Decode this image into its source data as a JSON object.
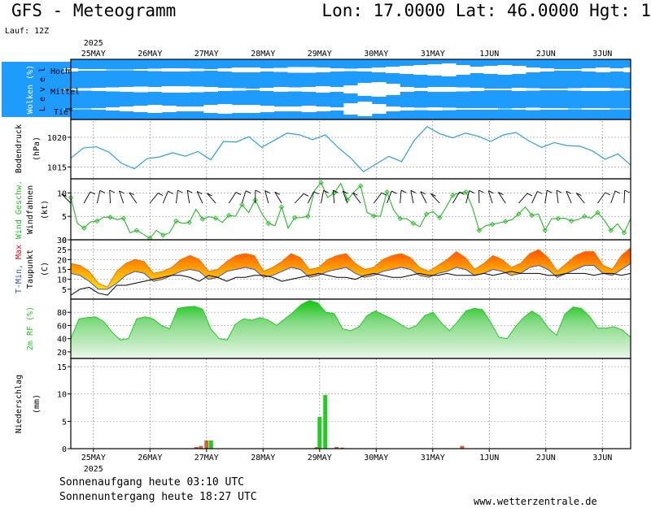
{
  "header": {
    "title": "GFS - Meteogramm",
    "coordinates": "Lon: 17.0000 Lat: 46.0000 Hgt: 1",
    "run": "Lauf: 12Z"
  },
  "footer": {
    "sunrise": "Sonnenaufgang heute 03:10 UTC",
    "sunset": "Sonnenuntergang heute 18:27 UTC",
    "source": "www.wetterzentrale.de"
  },
  "colors": {
    "cloud_bg": "#1e9bff",
    "cloud_fill": "#ffffff",
    "pressure_line": "#2aa0e0",
    "wind_line": "#22bb22",
    "tmax_fill": "#ff6a00",
    "tmin_fill": "#ffd200",
    "tmin_line": "#3355cc",
    "dewpoint_line": "#000000",
    "rh_fill": "#22cc22",
    "precip_bar": "#22cc22",
    "precip_bar_alt": "#cc6633",
    "grid": "#999999"
  },
  "chart_data": {
    "type": "meteogram",
    "year": "2025",
    "dates": [
      "25MAY",
      "26MAY",
      "27MAY",
      "28MAY",
      "29MAY",
      "30MAY",
      "31MAY",
      "1JUN",
      "2JUN",
      "3JUN"
    ],
    "x_start_day_offset": -0.4,
    "x_end_day_offset": 9.5,
    "panels": [
      {
        "id": "clouds",
        "ylabel": "Wolken (%)",
        "ylabel2": "L e v e l",
        "levels": [
          "Hoch",
          "Mittel",
          "Tief"
        ],
        "high": [
          0.2,
          0.1,
          0.1,
          0.05,
          0.05,
          0.1,
          0.15,
          0.2,
          0.2,
          0.15,
          0.1,
          0.2,
          0.3,
          0.3,
          0.2,
          0.25,
          0.35,
          0.35,
          0.3,
          0.2,
          0.15,
          0.2,
          0.3,
          0.4,
          0.5,
          0.6,
          0.7,
          0.8,
          0.6,
          0.4,
          0.5,
          0.6,
          0.5,
          0.3,
          0.2,
          0.1,
          0.1,
          0.2,
          0.3,
          0.2,
          0.3
        ],
        "mid": [
          0.1,
          0.15,
          0.2,
          0.25,
          0.3,
          0.35,
          0.3,
          0.4,
          0.4,
          0.35,
          0.3,
          0.2,
          0.15,
          0.1,
          0.2,
          0.3,
          0.25,
          0.3,
          0.4,
          0.3,
          0.5,
          0.8,
          0.9,
          0.7,
          0.3,
          0.2,
          0.3,
          0.3,
          0.25,
          0.2,
          0.1,
          0.1,
          0.2,
          0.15,
          0.1,
          0.1,
          0.15,
          0.2,
          0.2,
          0.15,
          0.1
        ],
        "low": [
          0.05,
          0.05,
          0.1,
          0.2,
          0.3,
          0.4,
          0.5,
          0.4,
          0.3,
          0.3,
          0.5,
          0.6,
          0.5,
          0.5,
          0.4,
          0.3,
          0.3,
          0.4,
          0.3,
          0.2,
          0.7,
          0.9,
          0.6,
          0.3,
          0.2,
          0.15,
          0.2,
          0.15,
          0.1,
          0.1,
          0.1,
          0.05,
          0.1,
          0.15,
          0.1,
          0.1,
          0.05,
          0.1,
          0.1,
          0.05,
          0.05
        ]
      },
      {
        "id": "pressure",
        "ylabel": "Bodendruck",
        "ylabel2": "(hPa)",
        "ylim": [
          1013,
          1023
        ],
        "yticks": [
          1015,
          1020
        ],
        "values": [
          1016.5,
          1018.2,
          1018.4,
          1017.5,
          1015.6,
          1014.7,
          1016.4,
          1016.7,
          1017.4,
          1016.8,
          1017.6,
          1016.2,
          1019.3,
          1019.2,
          1020.1,
          1018.3,
          1019.5,
          1020.7,
          1020.4,
          1019.6,
          1020.4,
          1018.3,
          1016.5,
          1014.2,
          1015.5,
          1016.8,
          1015.9,
          1019.5,
          1021.8,
          1020.6,
          1019.9,
          1020.7,
          1020.2,
          1019.3,
          1020.4,
          1020.8,
          1019.4,
          1018.3,
          1019.1,
          1018.6,
          1018.5,
          1017.7,
          1016.3,
          1017.2,
          1015.3
        ]
      },
      {
        "id": "wind",
        "ylabel": "Wind Geschw.",
        "ylabel2": "Windfahnen",
        "ylabel3": "(kt)",
        "ylim": [
          0,
          13
        ],
        "yticks": [
          0,
          5,
          10
        ],
        "values": [
          9.0,
          3.5,
          2.5,
          3.8,
          4.0,
          4.8,
          4.8,
          4.3,
          4.6,
          1.5,
          2.0,
          1.2,
          0.3,
          2.0,
          1.0,
          1.5,
          4.0,
          3.5,
          3.7,
          6.5,
          4.4,
          4.9,
          4.6,
          3.7,
          5.2,
          5.0,
          7.5,
          5.8,
          8.5,
          5.6,
          3.5,
          3.0,
          7.0,
          2.5,
          4.7,
          4.7,
          5.0,
          10.5,
          12.2,
          9.0,
          10.0,
          12.0,
          8.5,
          10.2,
          11.5,
          5.8,
          5.1,
          5.0,
          10.2,
          6.4,
          4.5,
          4.5,
          3.5,
          2.8,
          5.5,
          6.0,
          4.7,
          7.0,
          9.5,
          10.0,
          10.2,
          6.8,
          2.0,
          3.0,
          3.3,
          3.6,
          3.9,
          4.3,
          5.5,
          7.0,
          5.2,
          5.5,
          2.0,
          4.5,
          4.5,
          4.6,
          4.0,
          4.3,
          5.0,
          4.6,
          5.8,
          4.2,
          2.0,
          3.4,
          1.5,
          4.5
        ]
      },
      {
        "id": "temperature",
        "ylabel": "T-Min, Max",
        "ylabel2": "Taupunkt",
        "ylabel3": "(C)",
        "ylim": [
          0,
          30
        ],
        "yticks": [
          5,
          10,
          15,
          20,
          25,
          30
        ],
        "tmax": [
          18,
          17,
          14,
          8,
          6,
          14,
          18,
          20,
          19,
          13,
          14,
          16,
          20,
          22,
          20,
          14,
          15,
          19,
          22,
          23,
          22,
          14,
          16,
          19,
          23,
          21,
          15,
          16,
          20,
          22,
          23,
          18,
          15,
          16,
          20,
          22,
          23,
          21,
          16,
          14,
          17,
          20,
          24,
          21,
          15,
          18,
          22,
          20,
          16,
          18,
          23,
          25,
          21,
          14,
          18,
          22,
          24,
          24,
          17,
          15,
          22,
          26
        ],
        "tmin": [
          13,
          12,
          9,
          5,
          5,
          8,
          12,
          14,
          13,
          9,
          10,
          12,
          14,
          15,
          14,
          10,
          11,
          14,
          15,
          16,
          15,
          11,
          12,
          14,
          16,
          15,
          11,
          12,
          14,
          15,
          16,
          13,
          11,
          12,
          14,
          15,
          16,
          15,
          12,
          11,
          13,
          14,
          16,
          15,
          12,
          13,
          15,
          14,
          12,
          13,
          16,
          17,
          15,
          11,
          13,
          15,
          17,
          17,
          13,
          12,
          15,
          18
        ],
        "dewpoint": [
          2,
          5,
          6,
          3,
          2,
          7,
          7,
          8,
          9,
          10,
          11,
          12,
          12,
          11,
          9,
          12,
          11,
          9,
          11,
          11,
          12,
          12,
          11,
          9,
          10,
          11,
          12,
          13,
          12,
          11,
          11,
          10,
          12,
          13,
          12,
          11,
          11,
          12,
          13,
          12,
          12,
          13,
          12,
          12,
          12,
          13,
          12,
          13,
          14,
          13,
          13,
          13,
          12,
          12,
          13,
          13,
          13,
          12,
          13,
          13,
          12,
          13
        ]
      },
      {
        "id": "humidity",
        "ylabel": "2m RF (%)",
        "ylim": [
          10,
          100
        ],
        "yticks": [
          20,
          40,
          60,
          80
        ],
        "values": [
          40,
          70,
          72,
          73,
          66,
          50,
          38,
          40,
          70,
          73,
          70,
          60,
          55,
          86,
          88,
          89,
          85,
          55,
          40,
          38,
          62,
          70,
          68,
          72,
          68,
          60,
          70,
          80,
          92,
          98,
          94,
          80,
          78,
          55,
          52,
          58,
          75,
          82,
          76,
          70,
          62,
          55,
          60,
          75,
          80,
          64,
          52,
          66,
          82,
          86,
          84,
          65,
          42,
          40,
          58,
          72,
          82,
          74,
          56,
          45,
          77,
          88,
          86,
          74,
          56,
          56,
          58,
          53,
          42
        ]
      },
      {
        "id": "precip",
        "ylabel": "Niederschlag",
        "ylabel2": "(mm)",
        "ylim": [
          0,
          16.5
        ],
        "yticks": [
          0,
          5,
          10,
          15
        ],
        "bars": [
          {
            "day": 1.82,
            "value": 0.3,
            "kind": "alt"
          },
          {
            "day": 1.9,
            "value": 0.5,
            "kind": "alt"
          },
          {
            "day": 2.0,
            "value": 1.5,
            "kind": "alt"
          },
          {
            "day": 2.08,
            "value": 1.5,
            "kind": "rain"
          },
          {
            "day": 3.95,
            "value": 0.3,
            "kind": "alt"
          },
          {
            "day": 4.0,
            "value": 5.8,
            "kind": "rain"
          },
          {
            "day": 4.1,
            "value": 9.8,
            "kind": "rain"
          },
          {
            "day": 4.3,
            "value": 0.3,
            "kind": "alt"
          },
          {
            "day": 4.4,
            "value": 0.2,
            "kind": "alt"
          },
          {
            "day": 6.52,
            "value": 0.5,
            "kind": "alt"
          }
        ]
      }
    ]
  }
}
